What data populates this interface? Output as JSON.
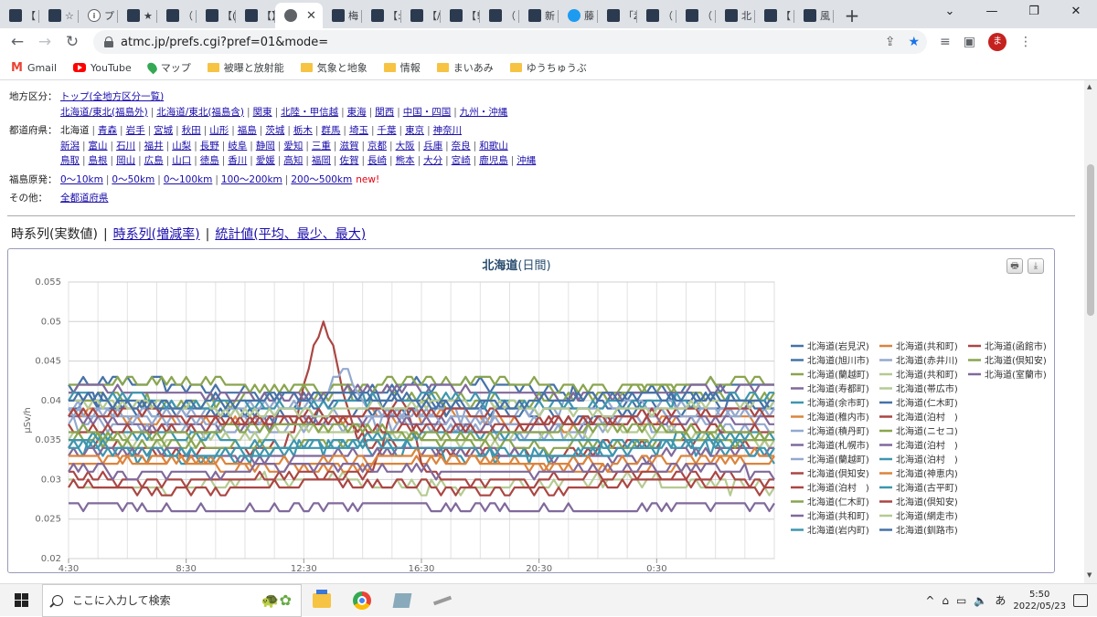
{
  "tabs": [
    {
      "icon": "page-icon",
      "label": "【"
    },
    {
      "icon": "page-icon",
      "label": "☆"
    },
    {
      "icon": "info-icon",
      "label": "プ"
    },
    {
      "icon": "page-icon",
      "label": "★"
    },
    {
      "icon": "page-icon",
      "label": "（"
    },
    {
      "icon": "page-icon",
      "label": "【("
    },
    {
      "icon": "page-icon",
      "label": "【】"
    },
    {
      "icon": "globe-icon",
      "label": "",
      "active": true
    },
    {
      "icon": "page-icon",
      "label": "梅"
    },
    {
      "icon": "page-icon",
      "label": "【:"
    },
    {
      "icon": "page-icon",
      "label": "【/"
    },
    {
      "icon": "page-icon",
      "label": "【!"
    },
    {
      "icon": "page-icon",
      "label": "（"
    },
    {
      "icon": "page-icon",
      "label": "新"
    },
    {
      "icon": "twitter-icon",
      "label": "藤"
    },
    {
      "icon": "page-icon",
      "label": "「ž"
    },
    {
      "icon": "page-icon",
      "label": "（"
    },
    {
      "icon": "page-icon",
      "label": "（"
    },
    {
      "icon": "page-icon",
      "label": "北"
    },
    {
      "icon": "page-icon",
      "label": "【"
    },
    {
      "icon": "page-icon",
      "label": "風"
    }
  ],
  "address_bar": {
    "url": "atmc.jp/prefs.cgi?pref=01&mode="
  },
  "profile": {
    "initial": "ま"
  },
  "bookmarks": [
    {
      "icon": "gmail-icon",
      "label": "Gmail"
    },
    {
      "icon": "youtube-icon",
      "label": "YouTube"
    },
    {
      "icon": "maps-icon",
      "label": "マップ"
    },
    {
      "icon": "folder-icon",
      "label": "被曝と放射能"
    },
    {
      "icon": "folder-icon",
      "label": "気象と地象"
    },
    {
      "icon": "folder-icon",
      "label": "情報"
    },
    {
      "icon": "folder-icon",
      "label": "まいあみ"
    },
    {
      "icon": "folder-icon",
      "label": "ゆうちゅうぶ"
    }
  ],
  "nav": {
    "region_label": "地方区分：",
    "region_lines": [
      [
        "トップ(全地方区分一覧)"
      ],
      [
        "北海道/東北(福島外)",
        "北海道/東北(福島含)",
        "関東",
        "北陸・甲信越",
        "東海",
        "関西",
        "中国・四国",
        "九州・沖縄"
      ]
    ],
    "pref_label": "都道府県：",
    "pref_current": "北海道",
    "pref_lines": [
      [
        "青森",
        "岩手",
        "宮城",
        "秋田",
        "山形",
        "福島",
        "茨城",
        "栃木",
        "群馬",
        "埼玉",
        "千葉",
        "東京",
        "神奈川"
      ],
      [
        "新潟",
        "富山",
        "石川",
        "福井",
        "山梨",
        "長野",
        "岐阜",
        "静岡",
        "愛知",
        "三重",
        "滋賀",
        "京都",
        "大阪",
        "兵庫",
        "奈良",
        "和歌山"
      ],
      [
        "鳥取",
        "島根",
        "岡山",
        "広島",
        "山口",
        "徳島",
        "香川",
        "愛媛",
        "高知",
        "福岡",
        "佐賀",
        "長崎",
        "熊本",
        "大分",
        "宮崎",
        "鹿児島",
        "沖縄"
      ]
    ],
    "fukushima_label": "福島原発：",
    "fukushima_links": [
      "0〜10km",
      "0〜50km",
      "0〜100km",
      "100〜200km",
      "200〜500km"
    ],
    "new_tag": "new!",
    "other_label": "その他：",
    "other_links": [
      "全都道府県"
    ]
  },
  "view_tabs": {
    "current": "時系列(実数値)",
    "links": [
      "時系列(増減率)",
      "統計値(平均、最少、最大)"
    ]
  },
  "chart_data": {
    "type": "line",
    "title": "北海道",
    "subtitle": "(日間)",
    "ylabel": "μSv/h",
    "xlabel": "",
    "x_tick_labels": [
      "4:30",
      "8:30",
      "12:30",
      "16:30",
      "20:30",
      "0:30"
    ],
    "x_start": "4:30",
    "x_step_minutes": 10,
    "points_per_series": 145,
    "ylim": [
      0.02,
      0.055
    ],
    "y_ticks": [
      0.02,
      0.025,
      0.03,
      0.035,
      0.04,
      0.045,
      0.05,
      0.055
    ],
    "grid": true,
    "legend_position": "right",
    "series": [
      {
        "name": "北海道(岩見沢)",
        "color": "#4572A7",
        "base": 0.0415,
        "amp": 0.0012,
        "phase": 0.3
      },
      {
        "name": "北海道(共和町)",
        "color": "#DB843D",
        "base": 0.0375,
        "amp": 0.001,
        "phase": 1.1
      },
      {
        "name": "北海道(函館市)",
        "color": "#AA4643",
        "base": 0.034,
        "amp": 0.001,
        "phase": 2.0,
        "peak": {
          "at": 0.36,
          "height": 0.015,
          "width": 0.05
        }
      },
      {
        "name": "北海道(旭川市)",
        "color": "#4572A7",
        "base": 0.0385,
        "amp": 0.001,
        "phase": 0.7
      },
      {
        "name": "北海道(赤井川)",
        "color": "#93A9CF",
        "base": 0.0365,
        "amp": 0.0012,
        "phase": 1.9
      },
      {
        "name": "北海道(倶知安)",
        "color": "#89A54E",
        "base": 0.0405,
        "amp": 0.0012,
        "phase": 2.5
      },
      {
        "name": "北海道(蘭越町)",
        "color": "#89A54E",
        "base": 0.042,
        "amp": 0.0009,
        "phase": 0.1
      },
      {
        "name": "北海道(共和町)",
        "color": "#B5CA92",
        "base": 0.0355,
        "amp": 0.0011,
        "phase": 2.9
      },
      {
        "name": "北海道(室蘭市)",
        "color": "#80699B",
        "base": 0.0265,
        "amp": 0.0006,
        "phase": 1.4
      },
      {
        "name": "北海道(寿都町)",
        "color": "#80699B",
        "base": 0.041,
        "amp": 0.0008,
        "phase": 0.9
      },
      {
        "name": "北海道(帯広市)",
        "color": "#B5CA92",
        "base": 0.0295,
        "amp": 0.001,
        "phase": 3.3
      },
      {
        "name": "北海道(余市町)",
        "color": "#3D96AE",
        "base": 0.0335,
        "amp": 0.0013,
        "phase": 2.2
      },
      {
        "name": "北海道(仁木町)",
        "color": "#4572A7",
        "base": 0.0395,
        "amp": 0.001,
        "phase": 1.6
      },
      {
        "name": "北海道(稚内市)",
        "color": "#DB843D",
        "base": 0.0318,
        "amp": 0.0008,
        "phase": 0.4
      },
      {
        "name": "北海道(泊村　)",
        "color": "#AA4643",
        "base": 0.0302,
        "amp": 0.0009,
        "phase": 2.7,
        "peak": {
          "at": 0.47,
          "height": 0.01,
          "width": 0.04
        }
      },
      {
        "name": "北海道(積丹町)",
        "color": "#93A9CF",
        "base": 0.0388,
        "amp": 0.0011,
        "phase": 3.0,
        "peak": {
          "at": 0.39,
          "height": 0.005,
          "width": 0.03
        }
      },
      {
        "name": "北海道(ニセコ)",
        "color": "#89A54E",
        "base": 0.0345,
        "amp": 0.0009,
        "phase": 1.2
      },
      {
        "name": "北海道(札幌市)",
        "color": "#80699B",
        "base": 0.0332,
        "amp": 0.0009,
        "phase": 0.6
      },
      {
        "name": "北海道(泊村　)",
        "color": "#80699B",
        "base": 0.0372,
        "amp": 0.001,
        "phase": 2.1
      },
      {
        "name": "北海道(蘭越町)",
        "color": "#93A9CF",
        "base": 0.0378,
        "amp": 0.0009,
        "phase": 1.7
      },
      {
        "name": "北海道(泊村　)",
        "color": "#3D96AE",
        "base": 0.0352,
        "amp": 0.001,
        "phase": 0.2
      },
      {
        "name": "北海道(倶知安)",
        "color": "#AA4643",
        "base": 0.0368,
        "amp": 0.001,
        "phase": 3.5
      },
      {
        "name": "北海道(神恵内)",
        "color": "#DB843D",
        "base": 0.0325,
        "amp": 0.0009,
        "phase": 1.0
      },
      {
        "name": "北海道(泊村　)",
        "color": "#AA4643",
        "base": 0.0291,
        "amp": 0.0008,
        "phase": 2.4
      },
      {
        "name": "北海道(古平町)",
        "color": "#3D96AE",
        "base": 0.0398,
        "amp": 0.001,
        "phase": 0.8
      },
      {
        "name": "北海道(仁木町)",
        "color": "#89A54E",
        "base": 0.0362,
        "amp": 0.0009,
        "phase": 3.1
      },
      {
        "name": "北海道(倶知安)",
        "color": "#AA4643",
        "base": 0.0382,
        "amp": 0.0009,
        "phase": 1.3
      },
      {
        "name": "北海道(共和町)",
        "color": "#80699B",
        "base": 0.0312,
        "amp": 0.0008,
        "phase": 2.6
      },
      {
        "name": "北海道(網走市)",
        "color": "#B5CA92",
        "base": 0.0392,
        "amp": 0.001,
        "phase": 0.5
      },
      {
        "name": "北海道(岩内町)",
        "color": "#3D96AE",
        "base": 0.0338,
        "amp": 0.0009,
        "phase": 1.8
      },
      {
        "name": "北海道(釧路市)",
        "color": "#4572A7",
        "base": 0.0402,
        "amp": 0.001,
        "phase": 2.8
      }
    ]
  },
  "taskbar": {
    "search_placeholder": "ここに入力して検索",
    "ime": "あ",
    "time": "5:50",
    "date": "2022/05/23"
  }
}
